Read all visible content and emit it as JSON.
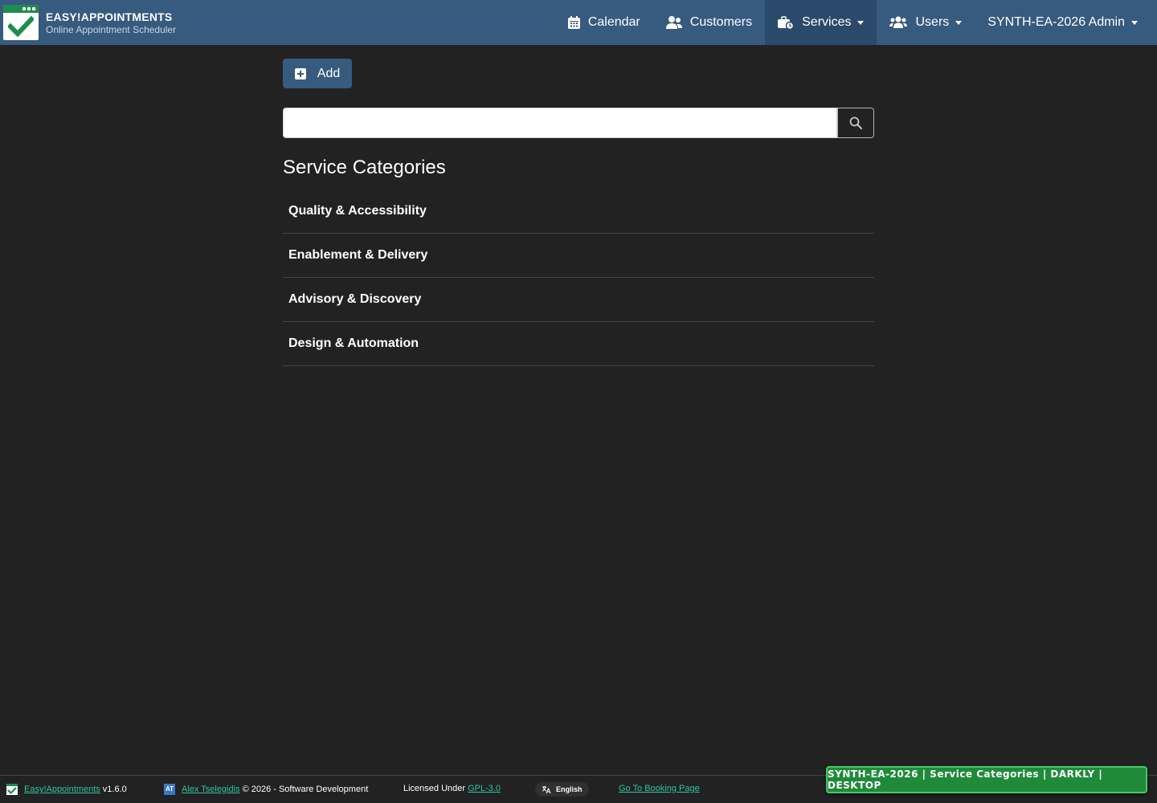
{
  "header": {
    "brand_title": "EASY!APPOINTMENTS",
    "brand_subtitle": "Online Appointment Scheduler",
    "nav": {
      "calendar": "Calendar",
      "customers": "Customers",
      "services": "Services",
      "users": "Users",
      "account": "SYNTH-EA-2026 Admin"
    },
    "active_item": "services",
    "color": "#375a7f"
  },
  "toolbar": {
    "add_label": "Add"
  },
  "search": {
    "value": "",
    "placeholder": ""
  },
  "main": {
    "title": "Service Categories",
    "categories": [
      "Quality & Accessibility",
      "Enablement & Delivery",
      "Advisory & Discovery",
      "Design & Automation"
    ]
  },
  "footer": {
    "app_link": "Easy!Appointments",
    "version": "v1.6.0",
    "author_link": "Alex Tselegidis",
    "copyright": "© 2026 - Software Development",
    "license_prefix": "Licensed Under",
    "license_link": "GPL-3.0",
    "language": "English",
    "booking_link": "Go To Booking Page"
  },
  "env_badge": "SYNTH-EA-2026 | Service Categories | DARKLY | DESKTOP",
  "colors": {
    "background": "#222222",
    "primary": "#375a7f",
    "link": "#2ec4a0",
    "badge": "#1f8a3a"
  }
}
